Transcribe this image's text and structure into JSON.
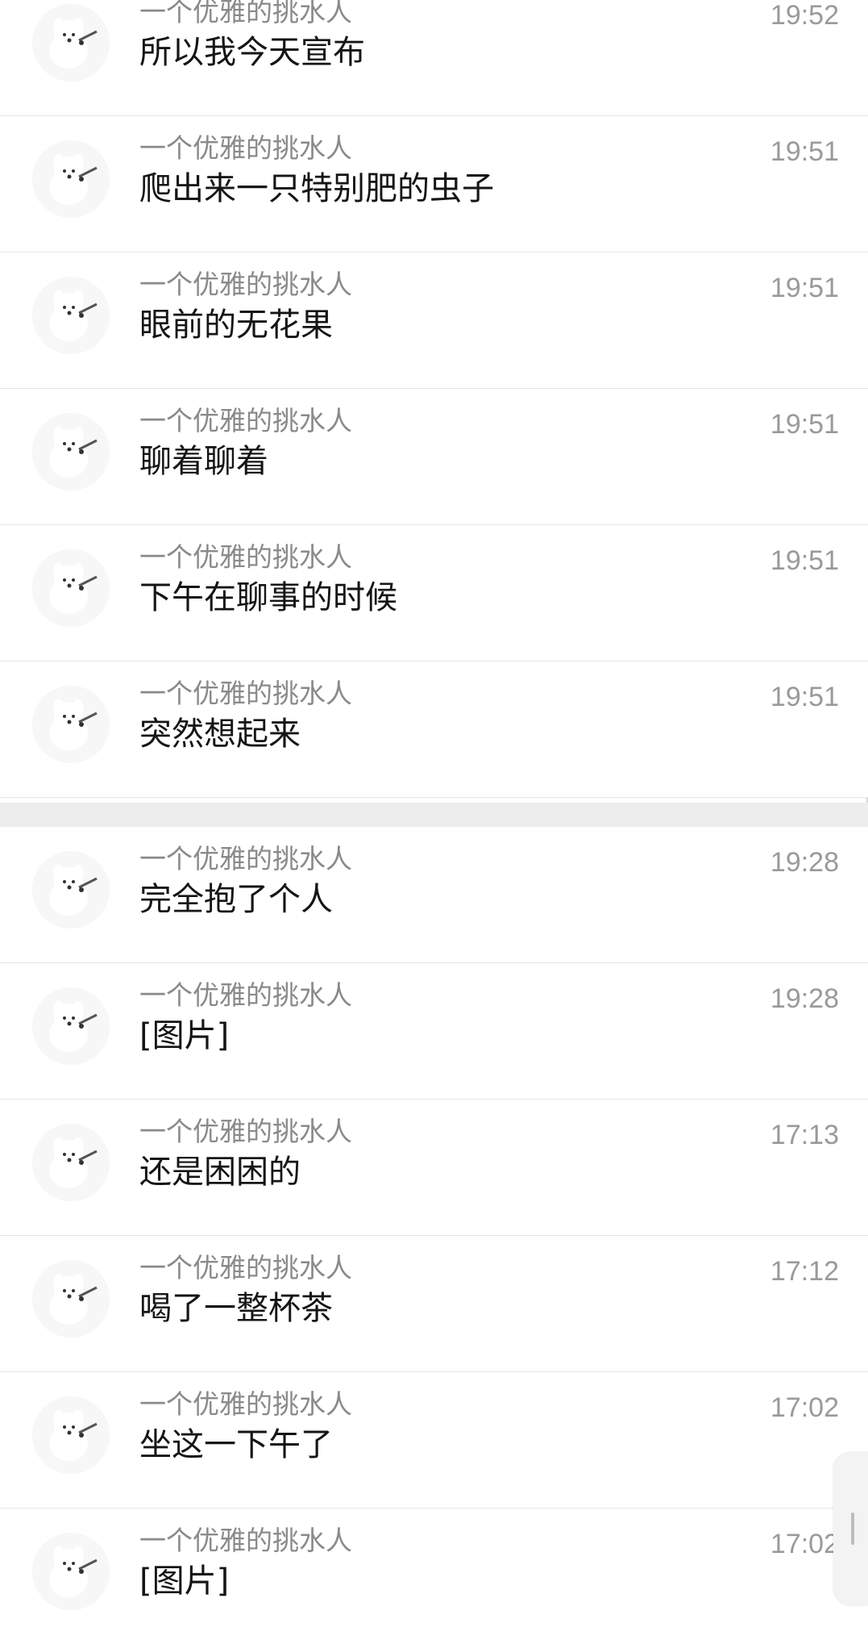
{
  "conversation": {
    "avatar_icon": "white-dog-icon",
    "messages_group_1": [
      {
        "sender": "一个优雅的挑水人",
        "text": "所以我今天宣布",
        "time": "19:52"
      },
      {
        "sender": "一个优雅的挑水人",
        "text": "爬出来一只特别肥的虫子",
        "time": "19:51"
      },
      {
        "sender": "一个优雅的挑水人",
        "text": "眼前的无花果",
        "time": "19:51"
      },
      {
        "sender": "一个优雅的挑水人",
        "text": "聊着聊着",
        "time": "19:51"
      },
      {
        "sender": "一个优雅的挑水人",
        "text": "下午在聊事的时候",
        "time": "19:51"
      },
      {
        "sender": "一个优雅的挑水人",
        "text": "突然想起来",
        "time": "19:51"
      }
    ],
    "messages_group_2": [
      {
        "sender": "一个优雅的挑水人",
        "text": "完全抱了个人",
        "time": "19:28"
      },
      {
        "sender": "一个优雅的挑水人",
        "text": "[图片]",
        "time": "19:28"
      },
      {
        "sender": "一个优雅的挑水人",
        "text": "还是困困的",
        "time": "17:13"
      },
      {
        "sender": "一个优雅的挑水人",
        "text": "喝了一整杯茶",
        "time": "17:12"
      },
      {
        "sender": "一个优雅的挑水人",
        "text": "坐这一下午了",
        "time": "17:02"
      },
      {
        "sender": "一个优雅的挑水人",
        "text": "[图片]",
        "time": "17:02"
      }
    ]
  }
}
